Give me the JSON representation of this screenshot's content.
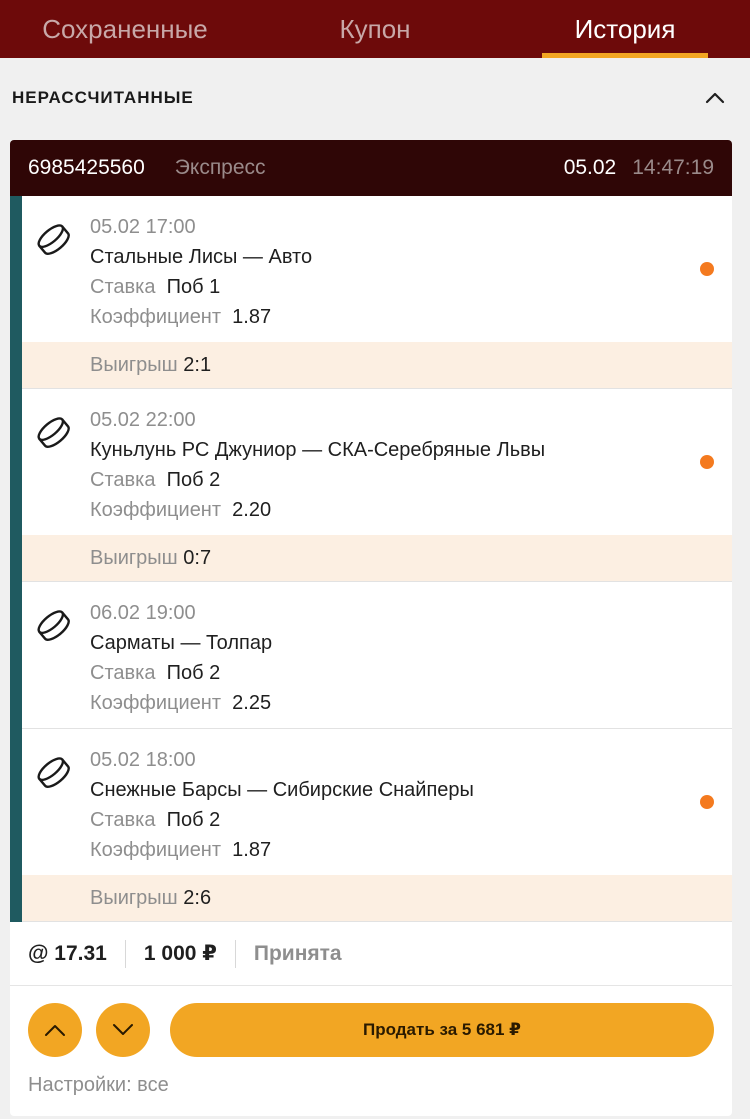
{
  "tabs": [
    {
      "label": "Сохраненные",
      "active": false
    },
    {
      "label": "Купон",
      "active": false
    },
    {
      "label": "История",
      "active": true
    }
  ],
  "section": {
    "title": "НЕРАССЧИТАННЫЕ",
    "collapse_icon": "chevron-up-icon"
  },
  "bet": {
    "id": "6985425560",
    "type": "Экспресс",
    "date": "05.02",
    "time": "14:47:19",
    "events": [
      {
        "datetime": "05.02 17:00",
        "teams": "Стальные Лисы — Авто",
        "stake_label": "Ставка",
        "stake": "Поб 1",
        "coef_label": "Коэффициент",
        "coef": "1.87",
        "score_label": "Выигрыш",
        "score": "2:1",
        "live": true
      },
      {
        "datetime": "05.02 22:00",
        "teams": "Куньлунь РС Джуниор — СКА-Серебряные Львы",
        "stake_label": "Ставка",
        "stake": "Поб 2",
        "coef_label": "Коэффициент",
        "coef": "2.20",
        "score_label": "Выигрыш",
        "score": "0:7",
        "live": true
      },
      {
        "datetime": "06.02 19:00",
        "teams": "Сарматы — Толпар",
        "stake_label": "Ставка",
        "stake": "Поб 2",
        "coef_label": "Коэффициент",
        "coef": "2.25",
        "live": false
      },
      {
        "datetime": "05.02 18:00",
        "teams": "Снежные Барсы — Сибирские Снайперы",
        "stake_label": "Ставка",
        "stake": "Поб 2",
        "coef_label": "Коэффициент",
        "coef": "1.87",
        "score_label": "Выигрыш",
        "score": "2:6",
        "live": true
      }
    ],
    "total_odds": "@ 17.31",
    "amount": "1 000 ₽",
    "status": "Принята",
    "sell_label": "Продать за 5 681 ₽",
    "settings": "Настройки: все"
  },
  "colors": {
    "header_bg": "#6d0a0a",
    "accent": "#f2a623",
    "card_head": "#2f0606",
    "live_dot": "#f47a1f",
    "rail": "#1f5a60"
  }
}
